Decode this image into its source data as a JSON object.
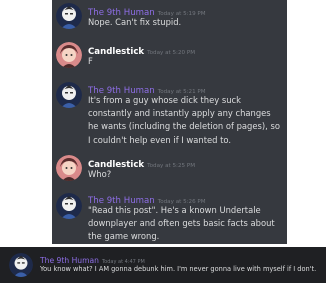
{
  "messages": [
    {
      "user": "The 9th Human",
      "time": "Today at 5:19 PM",
      "text": "Nope. Can't fix stupid."
    },
    {
      "user": "Candlestick",
      "time": "Today at 5:20 PM",
      "text": "F"
    },
    {
      "user": "The 9th Human",
      "time": "Today at 5:21 PM",
      "text": "It's from a guy whose dick they suck constantly and instantly apply any changes he wants (including the deletion of pages), so I couldn't help even if I wanted to."
    },
    {
      "user": "Candlestick",
      "time": "Today at 5:25 PM",
      "text": "Who?"
    },
    {
      "user": "The 9th Human",
      "time": "Today at 5:26 PM",
      "text": "\"Read this post\". He's a known Undertale downplayer and often gets basic facts about the game wrong."
    }
  ],
  "bottom_message": {
    "user": "The 9th Human",
    "time": "Today at 4:47 PM",
    "text": "You know what? I AM gonna debunk him. I'm never gonna live with myself if I don't."
  },
  "colors": {
    "panel_bg": "#36393f",
    "bottom_bg": "#1f2023",
    "username_purple": "#8e6ee6",
    "username_white": "#ffffff",
    "message_text": "#dcddde",
    "timestamp": "#72767d"
  },
  "icons": {
    "human_avatar": "human-avatar-icon",
    "candlestick_avatar": "candlestick-avatar-icon"
  }
}
